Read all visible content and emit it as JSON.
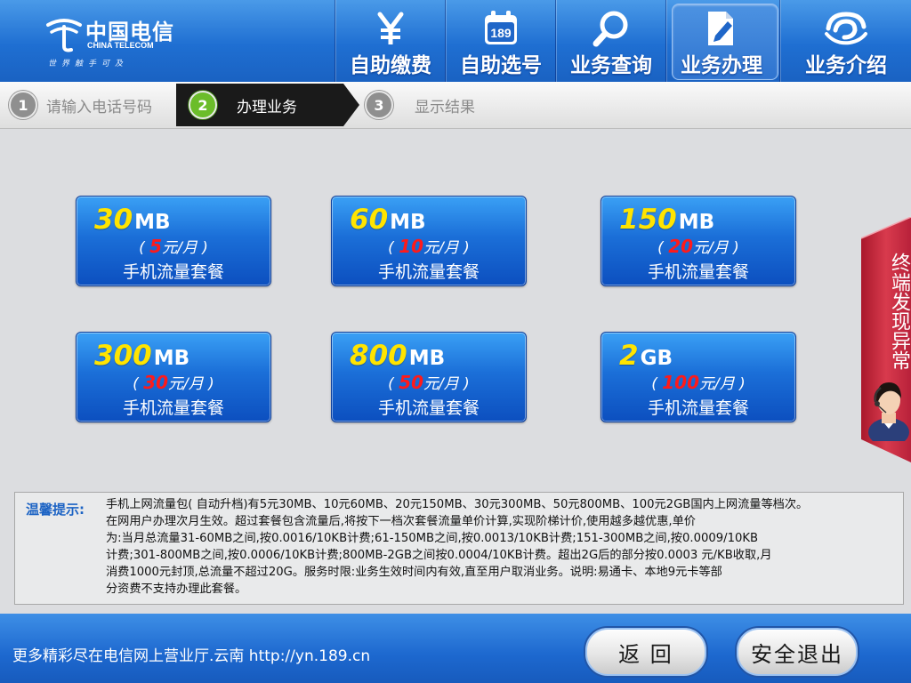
{
  "brand": {
    "cn": "中国电信",
    "en": "CHINA TELECOM",
    "tagline": "世界触手可及"
  },
  "nav": [
    {
      "label": "自助缴费",
      "icon": "yen-icon"
    },
    {
      "label": "自助选号",
      "icon": "calendar-189-icon",
      "icon_text": "189"
    },
    {
      "label": "业务查询",
      "icon": "magnifier-icon"
    },
    {
      "label": "业务办理",
      "icon": "document-pen-icon",
      "active": true
    },
    {
      "label": "业务介绍",
      "icon": "telecom-swirl-icon"
    }
  ],
  "steps": [
    {
      "num": "1",
      "label": "请输入电话号码"
    },
    {
      "num": "2",
      "label": "办理业务",
      "active": true
    },
    {
      "num": "3",
      "label": "显示结果"
    }
  ],
  "packages": [
    {
      "amount": "30",
      "unit": "MB",
      "price": "5",
      "price_unit": "元/月",
      "name": "手机流量套餐"
    },
    {
      "amount": "60",
      "unit": "MB",
      "price": "10",
      "price_unit": "元/月",
      "name": "手机流量套餐"
    },
    {
      "amount": "150",
      "unit": "MB",
      "price": "20",
      "price_unit": "元/月",
      "name": "手机流量套餐"
    },
    {
      "amount": "300",
      "unit": "MB",
      "price": "30",
      "price_unit": "元/月",
      "name": "手机流量套餐"
    },
    {
      "amount": "800",
      "unit": "MB",
      "price": "50",
      "price_unit": "元/月",
      "name": "手机流量套餐"
    },
    {
      "amount": "2",
      "unit": "GB",
      "price": "100",
      "price_unit": "元/月",
      "name": "手机流量套餐"
    }
  ],
  "side_tab": {
    "label": "终端发现异常"
  },
  "tips": {
    "title": "温馨提示:",
    "lines": [
      "手机上网流量包( 自动升档)有5元30MB、10元60MB、20元150MB、30元300MB、50元800MB、100元2GB国内上网流量等档次。",
      "在网用户办理次月生效。超过套餐包含流量后,将按下一档次套餐流量单价计算,实现阶梯计价,使用越多越优惠,单价",
      "为:当月总流量31-60MB之间,按0.0016/10KB计费;61-150MB之间,按0.0013/10KB计费;151-300MB之间,按0.0009/10KB",
      "计费;301-800MB之间,按0.0006/10KB计费;800MB-2GB之间按0.0004/10KB计费。超出2G后的部分按0.0003 元/KB收取,月",
      "消费1000元封顶,总流量不超过20G。服务时限:业务生效时间内有效,直至用户取消业务。说明:易通卡、本地9元卡等部",
      "分资费不支持办理此套餐。"
    ]
  },
  "footer": {
    "text": "更多精彩尽在电信网上营业厅.云南 http://yn.189.cn",
    "back_label": "返 回",
    "exit_label": "安全退出"
  },
  "colors": {
    "header_blue": "#1f6fd2",
    "amount_yellow": "#ffe400",
    "price_red": "#ff1a1a",
    "step_active_green": "#6bbd2a",
    "side_tab_red": "#c8263a"
  }
}
